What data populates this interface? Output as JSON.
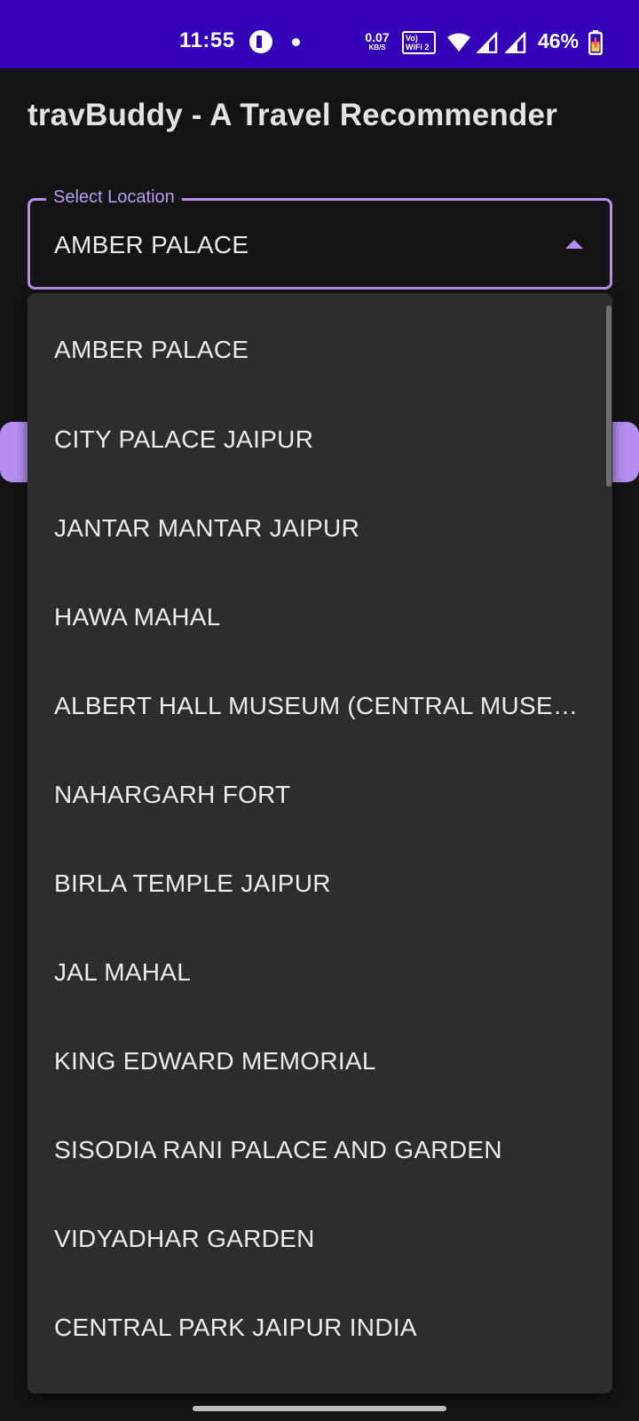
{
  "status_bar": {
    "time": "11:55",
    "net_speed_value": "0.07",
    "net_speed_unit": "KB/S",
    "volte_label": "Vo) WiFi 2",
    "battery_percent": "46%",
    "icons": [
      "app-notification-icon",
      "dot-icon",
      "wifi-icon",
      "signal-icon",
      "signal-icon",
      "battery-charging-icon"
    ]
  },
  "app_bar": {
    "title": "travBuddy - A Travel Recommender"
  },
  "select": {
    "label": "Select Location",
    "value": "AMBER PALACE",
    "accent_color": "#b58ef0"
  },
  "menu": {
    "items": [
      "AMBER PALACE",
      "CITY PALACE JAIPUR",
      "JANTAR MANTAR JAIPUR",
      "HAWA MAHAL",
      "ALBERT HALL MUSEUM (CENTRAL MUSE…",
      "NAHARGARH FORT",
      "BIRLA TEMPLE JAIPUR",
      "JAL MAHAL",
      "KING EDWARD MEMORIAL",
      "SISODIA RANI PALACE AND GARDEN",
      "VIDYADHAR GARDEN",
      "CENTRAL PARK JAIPUR INDIA"
    ]
  },
  "colors": {
    "status_bar": "#3300b8",
    "background": "#141414",
    "menu_surface": "#2d2d2d",
    "accent": "#b58ef0"
  }
}
